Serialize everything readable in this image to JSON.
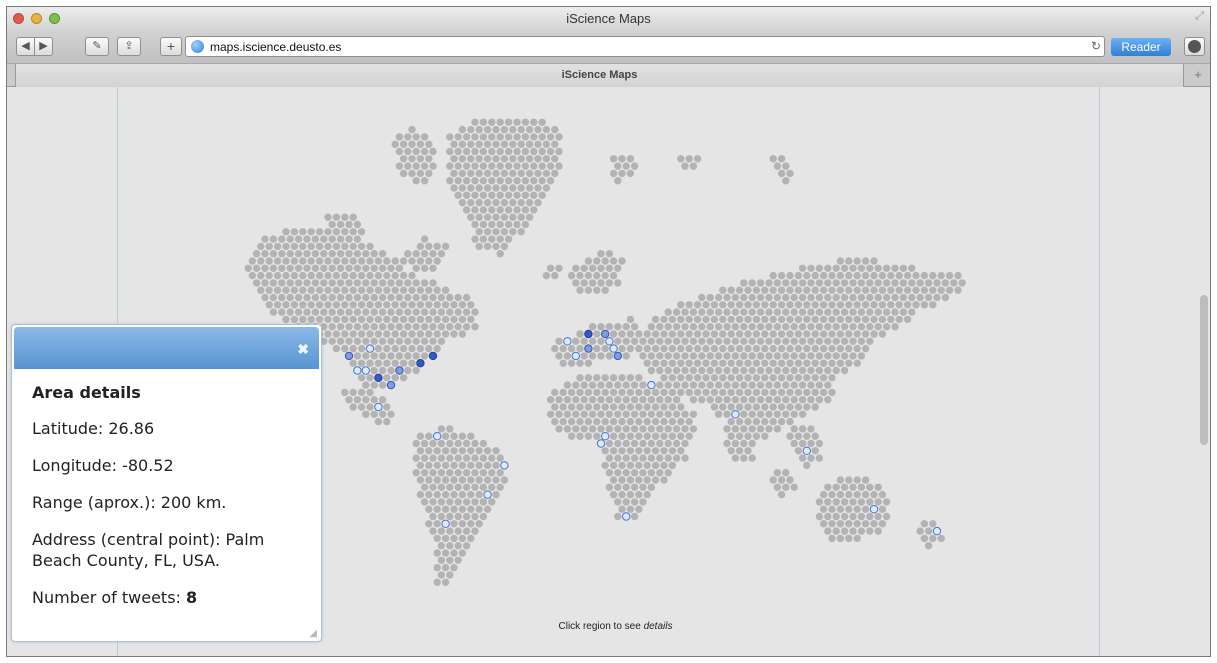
{
  "window": {
    "title": "iScience Maps"
  },
  "toolbar": {
    "url": "maps.iscience.deusto.es",
    "reader_label": "Reader",
    "plus_label": "+",
    "reload_icon": "reload-icon",
    "back_icon": "back-arrow-icon",
    "forward_icon": "forward-arrow-icon"
  },
  "tabs": [
    {
      "label": "iScience Maps"
    }
  ],
  "map": {
    "hint_text": "Click region to see ",
    "hint_emphasis": "details",
    "colors": {
      "land": "#b3b3b3",
      "low": "#dce8fb",
      "mid": "#7d9ce3",
      "high": "#3557c8"
    }
  },
  "panel": {
    "heading": "Area details",
    "latitude": "Latitude: 26.86",
    "longitude": "Longitude: -80.52",
    "range": "Range (aprox.): 200 km.",
    "address": "Address (central point): Palm Beach County, FL, USA.",
    "tweets_label": "Number of tweets: ",
    "tweets_value": "8",
    "close_icon": "close-icon"
  }
}
